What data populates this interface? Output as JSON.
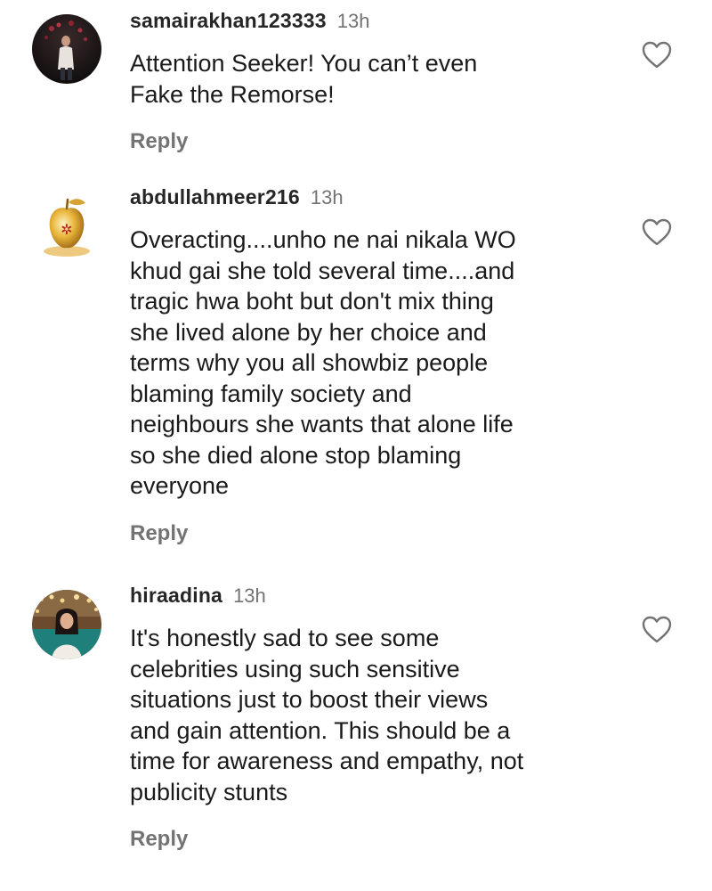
{
  "comments": [
    {
      "username": "samairakhan123333",
      "time": "13h",
      "text": "Attention Seeker! You can’t even\nFake the Remorse!",
      "reply_label": "Reply",
      "avatar_icon": "profile-photo",
      "like_icon": "heart-outline-icon"
    },
    {
      "username": "abdullahmeer216",
      "time": "13h",
      "text": "Overacting....unho ne nai nikala WO\nkhud gai she told several time....and\ntragic hwa boht but don't mix thing\nshe lived alone by her choice and\nterms why you all showbiz people\nblaming family society and\nneighbours she wants that alone life\nso she died alone stop blaming\neveryone",
      "reply_label": "Reply",
      "avatar_icon": "golden-apple-emblem",
      "like_icon": "heart-outline-icon"
    },
    {
      "username": "hiraadina",
      "time": "13h",
      "text": "It's honestly sad to see some\ncelebrities using such sensitive\nsituations just to boost their views\nand gain attention. This should be a\ntime for awareness and empathy, not\npublicity stunts",
      "reply_label": "Reply",
      "avatar_icon": "profile-photo",
      "like_icon": "heart-outline-icon"
    }
  ],
  "colors": {
    "username": "#262626",
    "secondary_text": "#737373",
    "body_text": "#1a1a1a",
    "background": "#ffffff"
  }
}
